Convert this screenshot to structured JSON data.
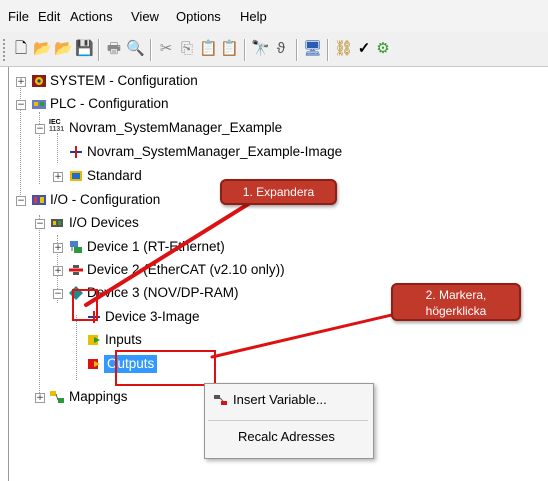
{
  "menu": [
    "File",
    "Edit",
    "Actions",
    "View",
    "Options",
    "Help"
  ],
  "toolbar_icons": [
    "new-icon",
    "open-icon",
    "open-folder-icon",
    "save-icon",
    "print-icon",
    "print-preview-icon",
    "cut-icon",
    "copy-icon",
    "paste-icon",
    "paste-special-icon",
    "find-icon",
    "lock-icon",
    "monitor-icon",
    "tree-icon",
    "check-icon",
    "activate-icon"
  ],
  "tree": {
    "system": "SYSTEM - Configuration",
    "plc": "PLC - Configuration",
    "plc_iec_badge": "IEC\n1131",
    "plc_project": "Novram_SystemManager_Example",
    "plc_image": "Novram_SystemManager_Example-Image",
    "plc_standard": "Standard",
    "io": "I/O - Configuration",
    "io_devices": "I/O Devices",
    "device1": "Device 1 (RT-Ethernet)",
    "device2": "Device 2 (EtherCAT (v2.10 only))",
    "device3": "Device 3 (NOV/DP-RAM)",
    "device3_image": "Device 3-Image",
    "inputs": "Inputs",
    "outputs": "Outputs",
    "mappings": "Mappings"
  },
  "callouts": {
    "expand": "1. Expandera",
    "mark": "2. Markera,\nhögerklicka"
  },
  "context_menu": {
    "insert": "Insert Variable...",
    "recalc": "Recalc Adresses"
  },
  "colors": {
    "callout": "#c0392b",
    "selection": "#3399ff",
    "highlight": "#dd1111"
  }
}
